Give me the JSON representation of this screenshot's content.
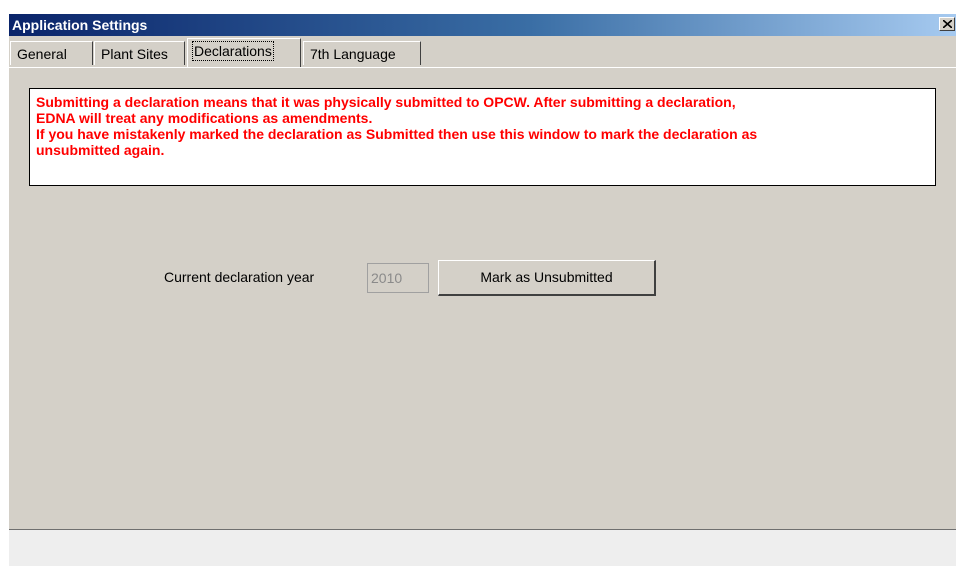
{
  "window": {
    "title": "Application Settings",
    "close_glyph": "×"
  },
  "tabs": [
    {
      "label": "General",
      "selected": false
    },
    {
      "label": "Plant Sites",
      "selected": false
    },
    {
      "label": "Declarations",
      "selected": true
    },
    {
      "label": "7th Language",
      "selected": false
    }
  ],
  "warning": {
    "lines": [
      "Submitting a declaration means that it was physically  submitted to OPCW. After submitting a declaration,",
      "EDNA will treat any modifications as amendments.",
      "If you have mistakenly marked the declaration as Submitted then use this window to mark the declaration as",
      "unsubmitted again."
    ],
    "color": "#ff0000"
  },
  "declaration": {
    "year_label": "Current declaration year",
    "year_value": "2010",
    "mark_button_label": "Mark as Unsubmitted"
  },
  "colors": {
    "title_bar_start": "#0a246a",
    "window_background": "#d4d0c8"
  }
}
